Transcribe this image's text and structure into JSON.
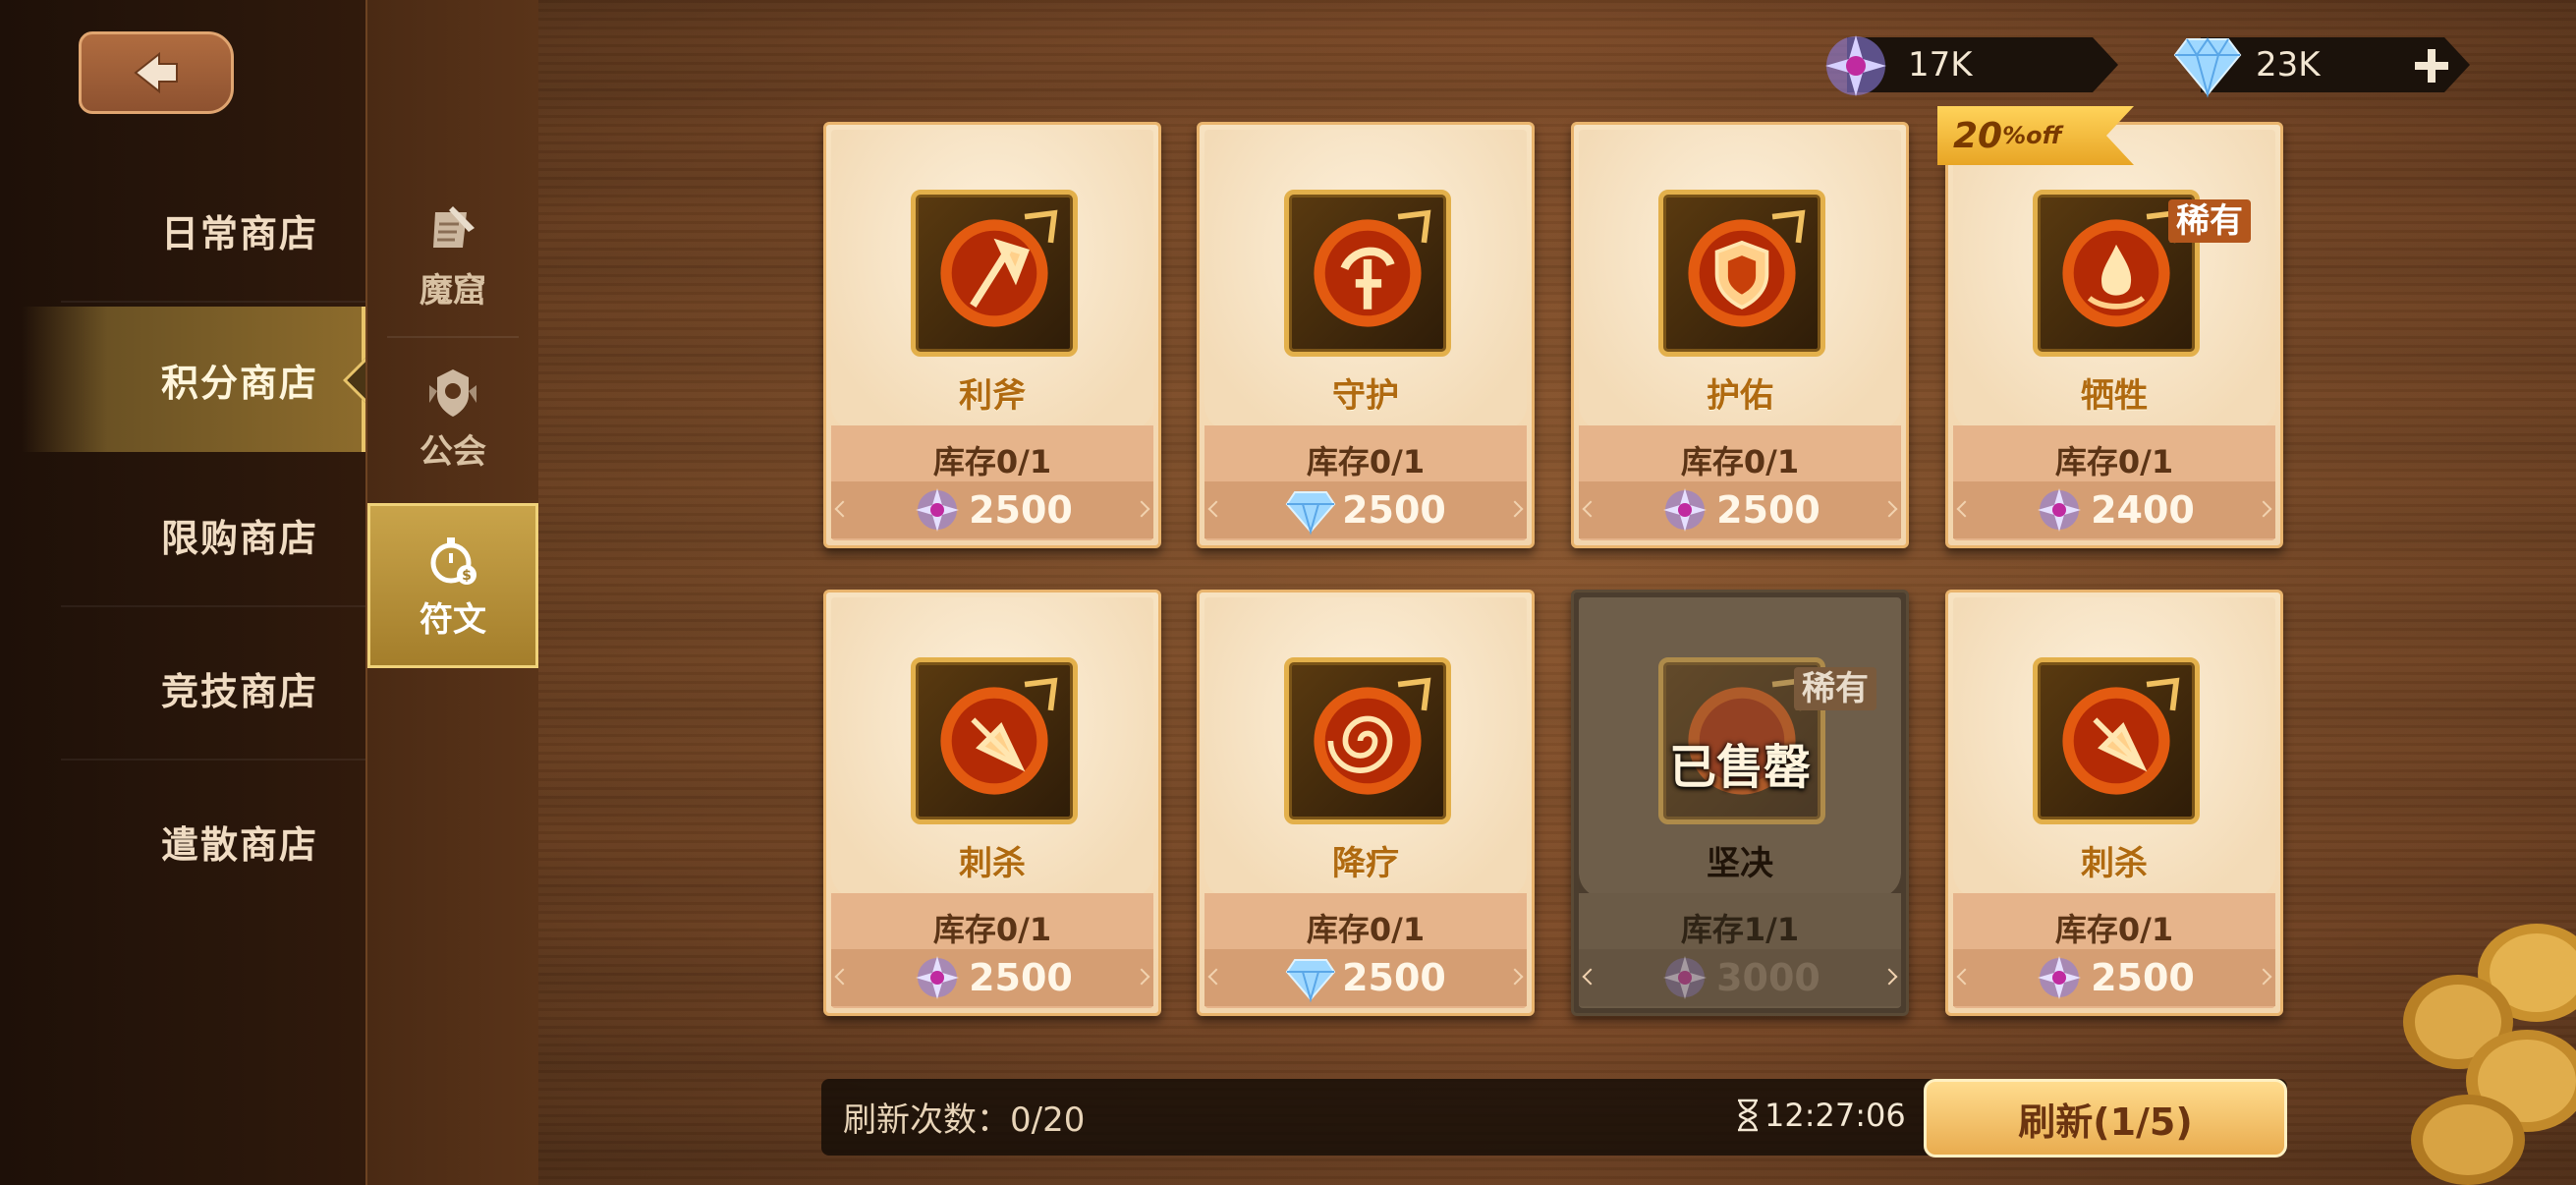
{
  "nav": {
    "items": [
      {
        "label": "日常商店"
      },
      {
        "label": "积分商店"
      },
      {
        "label": "限购商店"
      },
      {
        "label": "竞技商店"
      },
      {
        "label": "遣散商店"
      }
    ]
  },
  "subnav": {
    "items": [
      {
        "label": "魔窟"
      },
      {
        "label": "公会"
      },
      {
        "label": "符文"
      }
    ]
  },
  "currency": {
    "crystal": "17K",
    "diamond": "23K"
  },
  "discount": {
    "value": "20",
    "suffix": "%off"
  },
  "cards": [
    {
      "name": "利斧",
      "stock": "库存0/1",
      "price": "2500",
      "currency": "crystal"
    },
    {
      "name": "守护",
      "stock": "库存0/1",
      "price": "2500",
      "currency": "diamond"
    },
    {
      "name": "护佑",
      "stock": "库存0/1",
      "price": "2500",
      "currency": "crystal"
    },
    {
      "name": "牺牲",
      "stock": "库存0/1",
      "price": "2400",
      "currency": "crystal",
      "rare": "稀有"
    },
    {
      "name": "刺杀",
      "stock": "库存0/1",
      "price": "2500",
      "currency": "crystal"
    },
    {
      "name": "降疗",
      "stock": "库存0/1",
      "price": "2500",
      "currency": "diamond"
    },
    {
      "name": "坚决",
      "stock": "库存1/1",
      "price": "3000",
      "currency": "crystal",
      "rare": "稀有",
      "sold": "已售罄"
    },
    {
      "name": "刺杀",
      "stock": "库存0/1",
      "price": "2500",
      "currency": "crystal"
    }
  ],
  "footer": {
    "refresh_count": "刷新次数：0/20",
    "timer": "12:27:06",
    "refresh_button": "刷新(1/5)"
  },
  "colors": {
    "accent": "#e9b46d",
    "rune_frame": "#e3b04b",
    "active_nav": "#8d6c2c"
  }
}
